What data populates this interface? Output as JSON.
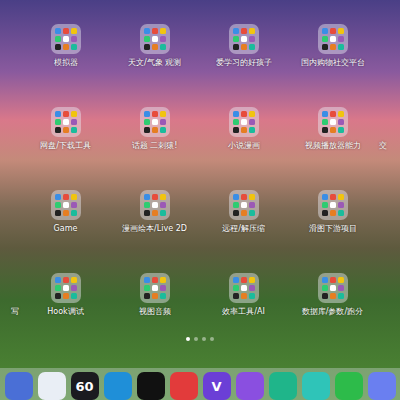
{
  "screen": "ipad-home",
  "folders": [
    {
      "label": ""
    },
    {
      "label": "模拟器"
    },
    {
      "label": "天文/气象 观测"
    },
    {
      "label": "爱学习的好孩子"
    },
    {
      "label": "国内购物社交平台"
    },
    {
      "label": ""
    },
    {
      "label": ""
    },
    {
      "label": "网盘/下载工具"
    },
    {
      "label": "话题 二刺猿!"
    },
    {
      "label": "小说漫画"
    },
    {
      "label": "视频播放器能力"
    },
    {
      "label": "交"
    },
    {
      "label": ""
    },
    {
      "label": "Game"
    },
    {
      "label": "漫画绘本/Live 2D"
    },
    {
      "label": "远程/解压缩"
    },
    {
      "label": "滑图下游项目"
    },
    {
      "label": ""
    },
    {
      "label": "写"
    },
    {
      "label": "Hook调试"
    },
    {
      "label": "视图音频"
    },
    {
      "label": "效率工具/AI"
    },
    {
      "label": "数据库/参数/跑分"
    },
    {
      "label": ""
    }
  ],
  "page_dots": [
    {
      "selected": true
    },
    {
      "selected": false
    },
    {
      "selected": false
    },
    {
      "selected": false
    }
  ],
  "dock": [
    {
      "label": "",
      "color": "#4a6fd6"
    },
    {
      "label": "",
      "color": "#e9eef5"
    },
    {
      "label": "60",
      "color": "#1b1b1f"
    },
    {
      "label": "",
      "color": "#1f8fd8"
    },
    {
      "label": "",
      "color": "#111111"
    },
    {
      "label": "",
      "color": "#e23b3b"
    },
    {
      "label": "V",
      "color": "#6b3fd6"
    },
    {
      "label": "",
      "color": "#8a4fe0"
    },
    {
      "label": "",
      "color": "#1fb58a"
    },
    {
      "label": "",
      "color": "#2fc4b8"
    },
    {
      "label": "",
      "color": "#2dbb4a"
    },
    {
      "label": "",
      "color": "#6a7ff0"
    }
  ]
}
